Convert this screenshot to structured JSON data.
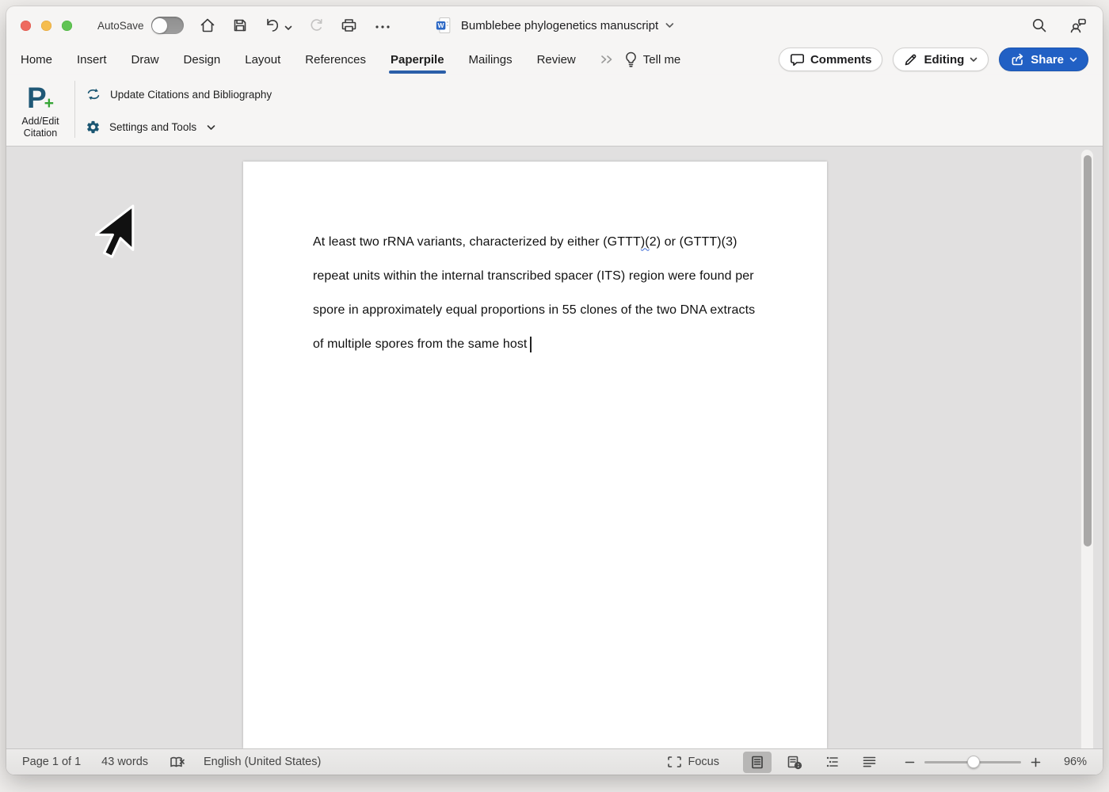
{
  "titlebar": {
    "autosave_label": "AutoSave",
    "document_title": "Bumblebee phylogenetics manuscript"
  },
  "icons": {
    "word_badge_letter": "W"
  },
  "tabs": {
    "items": [
      "Home",
      "Insert",
      "Draw",
      "Design",
      "Layout",
      "References",
      "Paperpile",
      "Mailings",
      "Review"
    ],
    "active": "Paperpile",
    "tell_me": "Tell me"
  },
  "actions": {
    "comments": "Comments",
    "editing": "Editing",
    "share": "Share"
  },
  "ribbon": {
    "logo_letter": "P",
    "logo_plus": "+",
    "add_line1": "Add/Edit",
    "add_line2": "Citation",
    "update_citations": "Update Citations and Bibliography",
    "settings_and_tools": "Settings and Tools"
  },
  "doc": {
    "line1_pre": "At least two rRNA variants, characterized by either (GTTT",
    "line1_mark": ")(",
    "line1_post": "2) or (GTTT)(3)",
    "line2": "repeat units within the internal transcribed spacer (ITS) region were found per",
    "line3": "spore in approximately equal proportions in 55 clones of the two DNA extracts",
    "line4": "of multiple spores from the same host"
  },
  "status": {
    "page": "Page 1 of 1",
    "words": "43 words",
    "language": "English (United States)",
    "focus": "Focus",
    "zoom": "96%"
  },
  "colors": {
    "accent_blue": "#2160c4",
    "tab_underline": "#2b5fa8",
    "paperpile_teal": "#1b5672",
    "logo_green": "#36a536",
    "grammar_underline": "#3b6ad6"
  }
}
